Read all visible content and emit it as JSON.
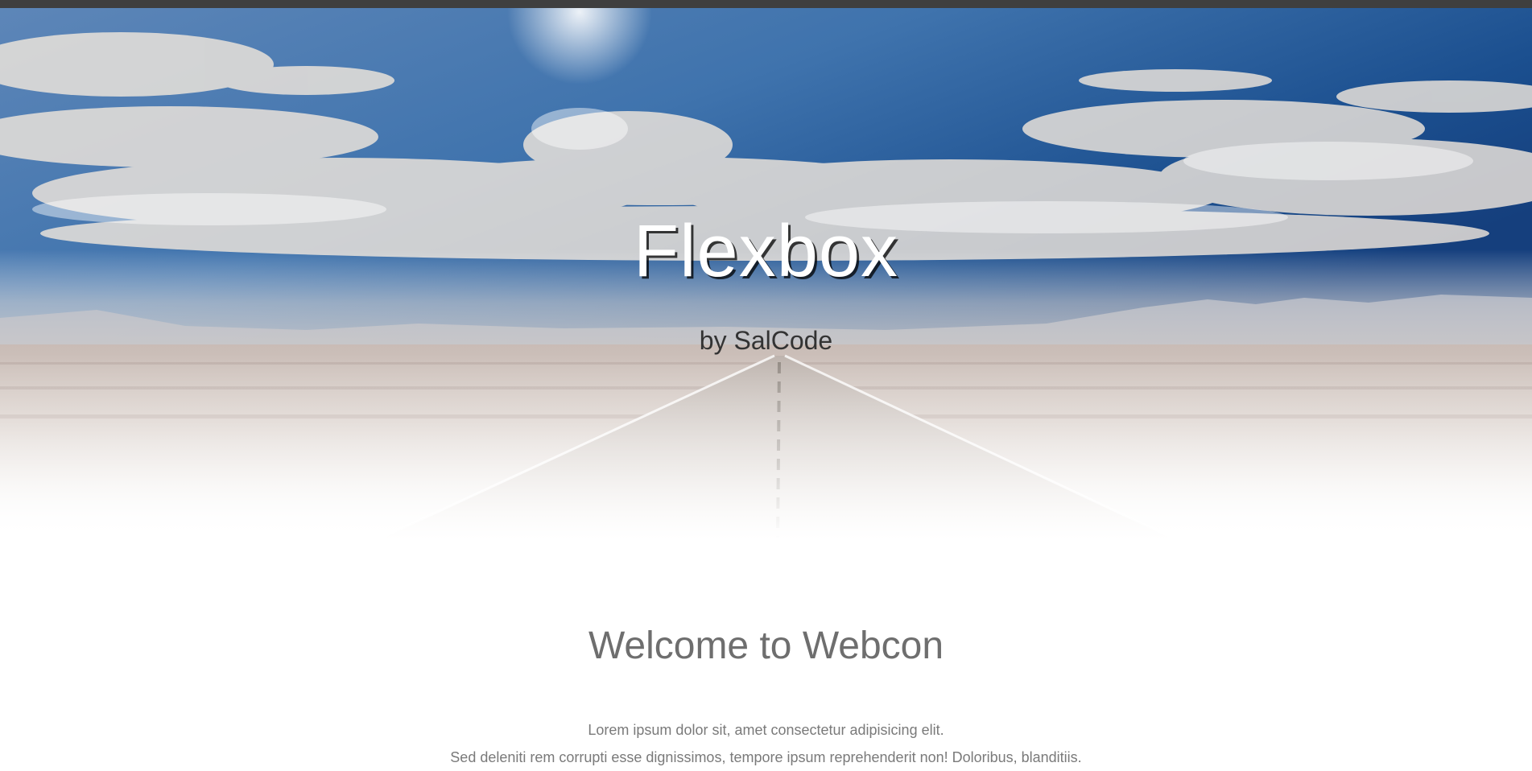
{
  "hero": {
    "title": "Flexbox",
    "subtitle": "by SalCode"
  },
  "welcome": {
    "heading": "Welcome to Webcon",
    "lines": [
      "Lorem ipsum dolor sit, amet consectetur adipisicing elit.",
      "Sed deleniti rem corrupti esse dignissimos, tempore ipsum reprehenderit non! Doloribus, blanditiis."
    ]
  },
  "colors": {
    "top_bar": "#3f3f3f",
    "sky_deep": "#1b4f8f",
    "sky_light": "#7fa6cf",
    "desert": "#cfc3bd",
    "heading_text": "#6e6e6e",
    "body_text": "#7a7a7a"
  }
}
